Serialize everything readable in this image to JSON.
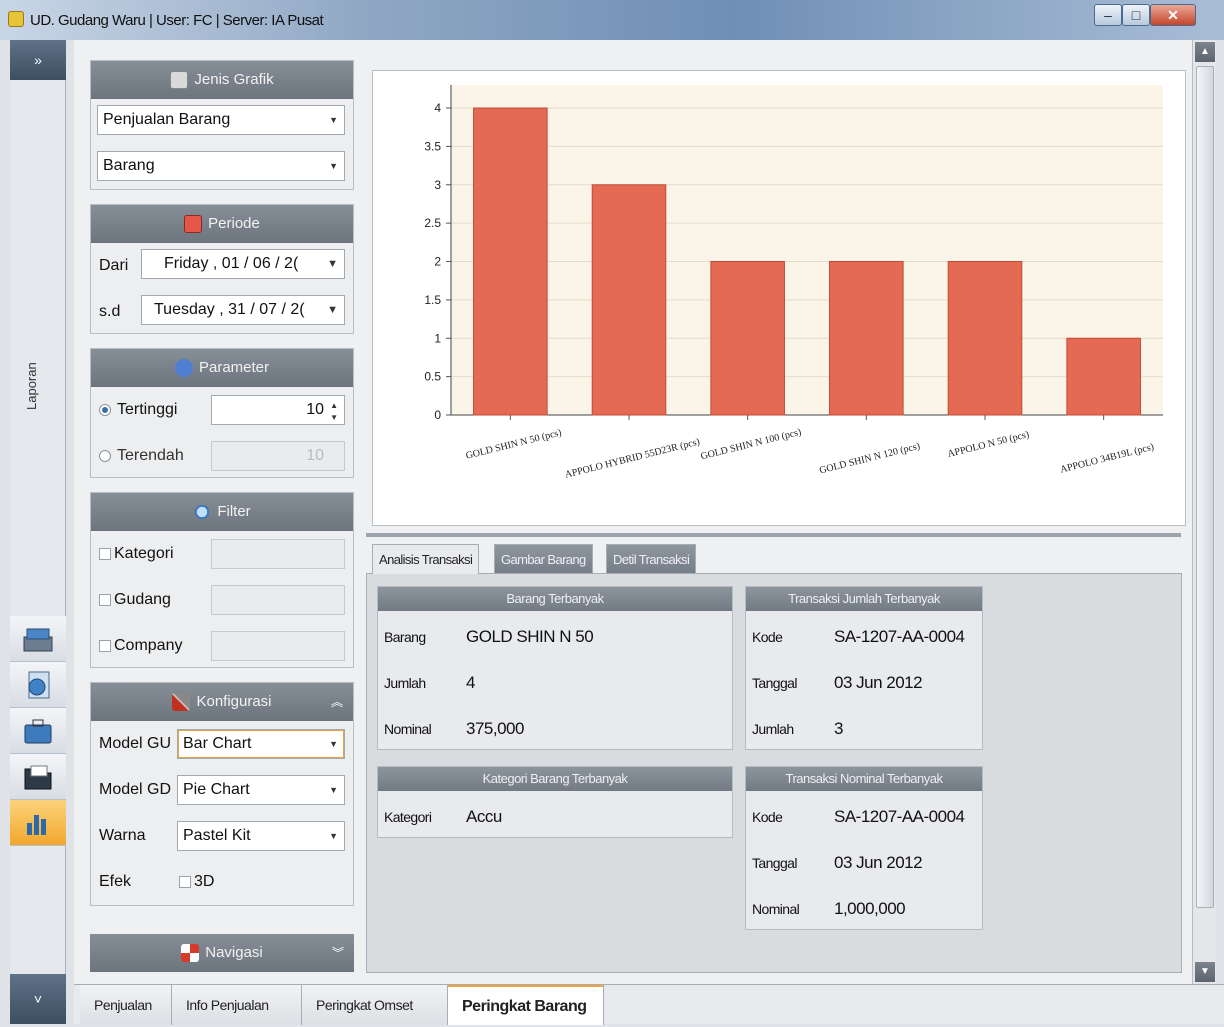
{
  "window": {
    "title": "UD. Gudang Waru | User: FC | Server: IA Pusat"
  },
  "strip": {
    "expand_glyph": "»",
    "label": "Laporan",
    "collapse_glyph": "˅",
    "icons": [
      "cashbox-icon",
      "globe-document-icon",
      "briefcase-icon",
      "folder-icon",
      "chart-report-icon"
    ]
  },
  "jenis_grafik": {
    "title": "Jenis Grafik",
    "type_value": "Penjualan Barang",
    "group_value": "Barang"
  },
  "periode": {
    "title": "Periode",
    "dari_label": "Dari",
    "dari_value": "Friday   , 01 / 06 / 2(",
    "sd_label": "s.d",
    "sd_value": "Tuesday  , 31 / 07 / 2("
  },
  "parameter": {
    "title": "Parameter",
    "tertinggi_label": "Tertinggi",
    "tertinggi_value": "10",
    "terendah_label": "Terendah",
    "terendah_value": "10"
  },
  "filter": {
    "title": "Filter",
    "kategori_label": "Kategori",
    "gudang_label": "Gudang",
    "company_label": "Company"
  },
  "konfigurasi": {
    "title": "Konfigurasi",
    "model_gu_label": "Model GU",
    "model_gu_value": "Bar Chart",
    "model_gd_label": "Model GD",
    "model_gd_value": "Pie Chart",
    "warna_label": "Warna",
    "warna_value": "Pastel Kit",
    "efek_label": "Efek",
    "efek_value": "3D"
  },
  "navigasi": {
    "title": "Navigasi"
  },
  "chart_data": {
    "type": "bar",
    "categories": [
      "GOLD SHIN N 50 (pcs)",
      "APPOLO HYBRID 55D23R (pcs)",
      "GOLD SHIN N 100 (pcs)",
      "GOLD SHIN N 120 (pcs)",
      "APPOLO N 50 (pcs)",
      "APPOLO 34B19L (pcs)"
    ],
    "values": [
      4,
      3,
      2,
      2,
      2,
      1
    ],
    "ylim": [
      0,
      4.3
    ],
    "yticks": [
      "0",
      "0.5",
      "1",
      "1.5",
      "2",
      "2.5",
      "3",
      "3.5",
      "4"
    ],
    "bar_color": "#e56a53",
    "plot_background": "#faf5e8",
    "grid": true
  },
  "tabs": {
    "t1": "Analisis Transaksi",
    "t2": "Gambar Barang",
    "t3": "Detil Transaksi"
  },
  "barang_terbanyak": {
    "title": "Barang Terbanyak",
    "k1": "Barang",
    "v1": "GOLD SHIN N 50",
    "k2": "Jumlah",
    "v2": "4",
    "k3": "Nominal",
    "v3": "375,000"
  },
  "kategori_terbanyak": {
    "title": "Kategori Barang Terbanyak",
    "k1": "Kategori",
    "v1": "Accu"
  },
  "jumlah_terbanyak": {
    "title": "Transaksi Jumlah Terbanyak",
    "k1": "Kode",
    "v1": "SA-1207-AA-0004",
    "k2": "Tanggal",
    "v2": "03 Jun 2012",
    "k3": "Jumlah",
    "v3": "3"
  },
  "nominal_terbanyak": {
    "title": "Transaksi Nominal Terbanyak",
    "k1": "Kode",
    "v1": "SA-1207-AA-0004",
    "k2": "Tanggal",
    "v2": "03 Jun 2012",
    "k3": "Nominal",
    "v3": "1,000,000"
  },
  "bottom_tabs": {
    "b1": "Penjualan",
    "b2": "Info Penjualan",
    "b3": "Peringkat Omset",
    "b4": "Peringkat Barang"
  }
}
